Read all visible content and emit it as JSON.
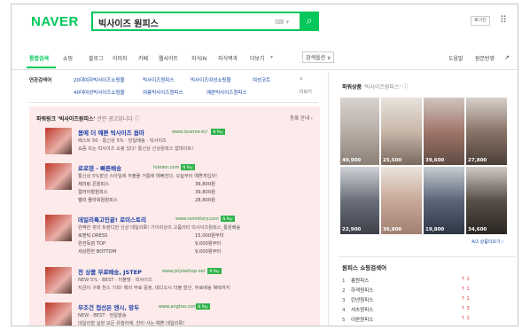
{
  "header": {
    "logo": "NAVER",
    "query": "빅사이즈 원피스",
    "keyboard": "⌨ ▾",
    "search_icon": "⌕",
    "login": "로그인",
    "apps_icon": "⠿"
  },
  "nav": {
    "tabs": [
      "통합검색",
      "쇼핑",
      "블로그",
      "이미지",
      "카페",
      "웹사이트",
      "지식iN",
      "지식백과",
      "더보기"
    ],
    "more_arrow": "▾",
    "options": "검색옵션 ∨",
    "help": "도움말",
    "feedback": "원본반영",
    "share_icon": "↗"
  },
  "related": {
    "title": "연관검색어",
    "row1": [
      "20대여자빅사이즈쇼핑몰",
      "빅사이즈원피스",
      "빅사이즈여성쇼핑몰",
      "여성코트"
    ],
    "row2": [
      "40대여성빅사이즈쇼핑몰",
      "여름빅사이즈원피스",
      "예쁜빅사이즈원피스"
    ],
    "more": "더보기"
  },
  "powerlink": {
    "title": "파워링크",
    "query": "'빅사이즈원피스'",
    "note": "관련 광고입니다",
    "register": "등록 안내 ›",
    "ads": [
      {
        "title": "몸에 더 예쁜 빅사이즈 옵마",
        "url": "www.loveme.kr/",
        "np": "N Pay",
        "lines": [
          "베스트 50 · 통신상 5% · 당일배송 · 빅사이즈",
          "요즘 뜨는 빅사이즈 쇼핑 있다! 통신상 신상원피스 없데이트!"
        ],
        "prices": []
      },
      {
        "title": "로로덴 - 빠른배송",
        "url": "lotelen.com",
        "np": "N Pay",
        "lines": [
          "통신상 5%할인 스타일에 추출물 거름에 예뻐진다. 오늘부터 예쁜게입자!"
        ],
        "prices": [
          [
            "체리링 꼰원피스",
            "36,800원"
          ],
          [
            "컬러야할원피스",
            "39,800원"
          ],
          [
            "밸리 플라워원원피스",
            "28,800원"
          ]
        ]
      },
      {
        "title": "데일리룩고민끝! 로미스토리",
        "url": "www.romistory.com",
        "np": "N Pay",
        "lines": [
          "완벽한 핏의 트렌디한 신상 데일리룩! 기이미상의 고품리티 빅사이즈원피스_통원배송"
        ],
        "prices": [
          [
            "로맨틱 DRESS",
            "15,000원부터"
          ],
          [
            "완전독점 TOP",
            "9,000원부터"
          ],
          [
            "세상편한 BOTTOM",
            "9,000원부터"
          ]
        ]
      },
      {
        "title": "전 상품 무료배송, JSTEP",
        "url": "www.jstyleshop.net",
        "np": "N Pay",
        "lines": [
          "NEW 5% · BEST · 이블벳 · 빅사이즈",
          "지금이 구매 찬스 기회! 해외 무료 증정, 데디오시 더블 할인, 무료배송 혜택까지"
        ],
        "prices": []
      },
      {
        "title": "무조건 접선은 엔시, 망두",
        "url": "www.angtoo.com",
        "np": "N Pay",
        "lines": [
          "NEW · BEST · 당일발송",
          "데일리할 실장 모든 유행자재, 찬미 사는 예쁜 데일리룩!"
        ],
        "prices": []
      }
    ]
  },
  "shopping": {
    "title": "파워상품",
    "query": "'빅사이즈원피스'",
    "info_icon": "ⓘ",
    "prices_row1": [
      "49,900",
      "25,500",
      "39,600",
      "27,800"
    ],
    "prices_row2": [
      "22,900",
      "36,800",
      "19,800",
      "34,600"
    ],
    "more": "4/2 상품더보기 ›"
  },
  "ranking": {
    "title": "원피스 쇼핑검색어",
    "items": [
      {
        "rank": "1",
        "name": "롱원피스",
        "change": "↑ 1"
      },
      {
        "rank": "2",
        "name": "하객원피스",
        "change": "↑ 1"
      },
      {
        "rank": "3",
        "name": "린넨원피스",
        "change": "↑ 1"
      },
      {
        "rank": "4",
        "name": "셔츠원피스",
        "change": "↑ 3"
      },
      {
        "rank": "5",
        "name": "이쁜원피스",
        "change": "↑ 1"
      }
    ]
  },
  "colors": {
    "brand": "#03c75a",
    "ad_bg": "#fdeaea",
    "link": "#1b3fa8"
  }
}
